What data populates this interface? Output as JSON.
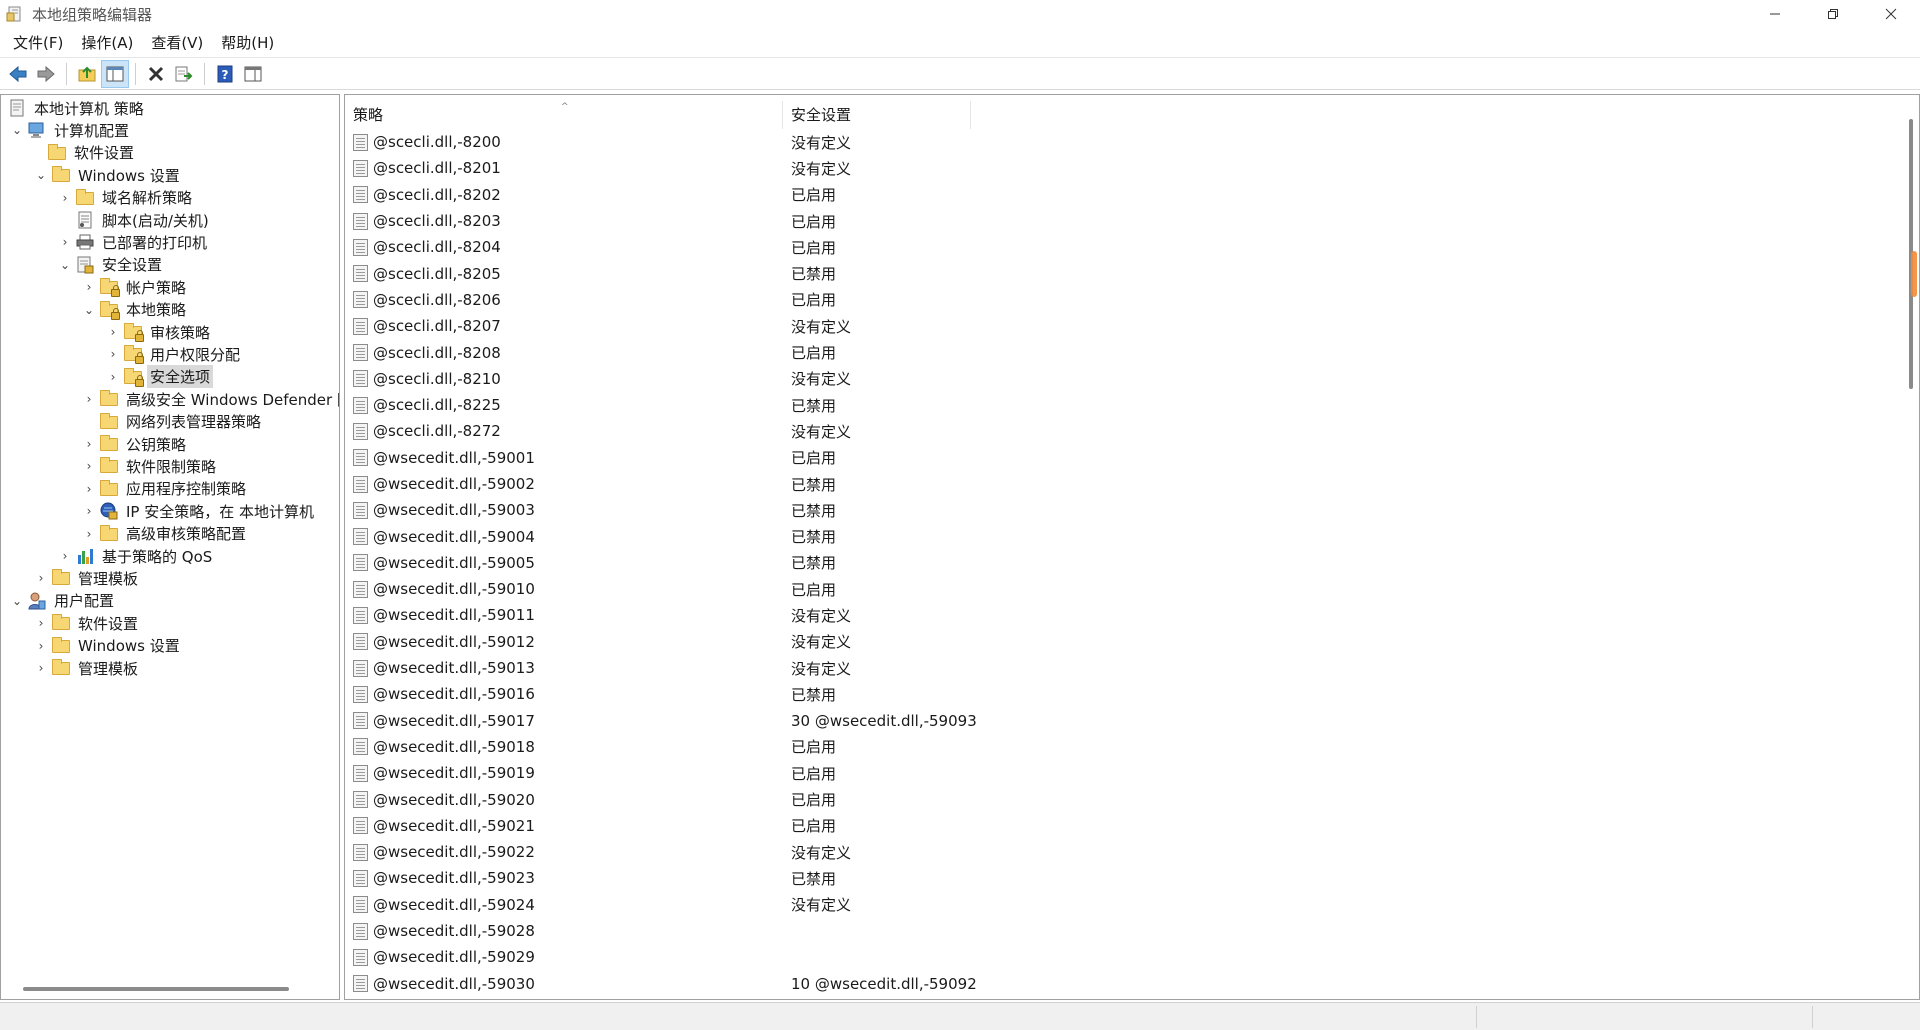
{
  "window": {
    "title": "本地组策略编辑器",
    "icon": "gpedit-app-icon",
    "controls": [
      "minimize-icon",
      "restore-icon",
      "close-icon"
    ]
  },
  "menu": {
    "file": "文件(F)",
    "action": "操作(A)",
    "view": "查看(V)",
    "help": "帮助(H)"
  },
  "toolbar": {
    "buttons": [
      "back-arrow-icon",
      "forward-arrow-icon",
      "up-folder-icon",
      "show-hide-tree-icon",
      "delete-icon",
      "export-list-icon",
      "help-icon",
      "properties-pane-icon"
    ]
  },
  "tree": {
    "items": [
      {
        "label": "本地计算机 策略",
        "icon": "policy-doc"
      },
      {
        "label": "计算机配置",
        "icon": "computer"
      },
      {
        "label": "软件设置",
        "icon": "folder"
      },
      {
        "label": "Windows 设置",
        "icon": "folder"
      },
      {
        "label": "域名解析策略",
        "icon": "folder"
      },
      {
        "label": "脚本(启动/关机)",
        "icon": "script"
      },
      {
        "label": "已部署的打印机",
        "icon": "printer"
      },
      {
        "label": "安全设置",
        "icon": "security"
      },
      {
        "label": "帐户策略",
        "icon": "folder-lock"
      },
      {
        "label": "本地策略",
        "icon": "folder-lock"
      },
      {
        "label": "审核策略",
        "icon": "folder-lock"
      },
      {
        "label": "用户权限分配",
        "icon": "folder-lock"
      },
      {
        "label": "安全选项",
        "icon": "folder-lock"
      },
      {
        "label": "高级安全 Windows Defender 防",
        "icon": "folder"
      },
      {
        "label": "网络列表管理器策略",
        "icon": "folder"
      },
      {
        "label": "公钥策略",
        "icon": "folder"
      },
      {
        "label": "软件限制策略",
        "icon": "folder"
      },
      {
        "label": "应用程序控制策略",
        "icon": "folder"
      },
      {
        "label": "IP 安全策略，在 本地计算机",
        "icon": "ip-security"
      },
      {
        "label": "高级审核策略配置",
        "icon": "folder"
      },
      {
        "label": "基于策略的 QoS",
        "icon": "qos-chart"
      },
      {
        "label": "管理模板",
        "icon": "folder"
      },
      {
        "label": "用户配置",
        "icon": "user"
      },
      {
        "label": "软件设置",
        "icon": "folder"
      },
      {
        "label": "Windows 设置",
        "icon": "folder"
      },
      {
        "label": "管理模板",
        "icon": "folder"
      }
    ]
  },
  "list": {
    "columns": {
      "policy": "策略",
      "setting": "安全设置"
    },
    "rows": [
      {
        "policy": "@scecli.dll,-8200",
        "setting": "没有定义"
      },
      {
        "policy": "@scecli.dll,-8201",
        "setting": "没有定义"
      },
      {
        "policy": "@scecli.dll,-8202",
        "setting": "已启用"
      },
      {
        "policy": "@scecli.dll,-8203",
        "setting": "已启用"
      },
      {
        "policy": "@scecli.dll,-8204",
        "setting": "已启用"
      },
      {
        "policy": "@scecli.dll,-8205",
        "setting": "已禁用"
      },
      {
        "policy": "@scecli.dll,-8206",
        "setting": "已启用"
      },
      {
        "policy": "@scecli.dll,-8207",
        "setting": "没有定义"
      },
      {
        "policy": "@scecli.dll,-8208",
        "setting": "已启用"
      },
      {
        "policy": "@scecli.dll,-8210",
        "setting": "没有定义"
      },
      {
        "policy": "@scecli.dll,-8225",
        "setting": "已禁用"
      },
      {
        "policy": "@scecli.dll,-8272",
        "setting": "没有定义"
      },
      {
        "policy": "@wsecedit.dll,-59001",
        "setting": "已启用"
      },
      {
        "policy": "@wsecedit.dll,-59002",
        "setting": "已禁用"
      },
      {
        "policy": "@wsecedit.dll,-59003",
        "setting": "已禁用"
      },
      {
        "policy": "@wsecedit.dll,-59004",
        "setting": "已禁用"
      },
      {
        "policy": "@wsecedit.dll,-59005",
        "setting": "已禁用"
      },
      {
        "policy": "@wsecedit.dll,-59010",
        "setting": "已启用"
      },
      {
        "policy": "@wsecedit.dll,-59011",
        "setting": "没有定义"
      },
      {
        "policy": "@wsecedit.dll,-59012",
        "setting": "没有定义"
      },
      {
        "policy": "@wsecedit.dll,-59013",
        "setting": "没有定义"
      },
      {
        "policy": "@wsecedit.dll,-59016",
        "setting": "已禁用"
      },
      {
        "policy": "@wsecedit.dll,-59017",
        "setting": "30 @wsecedit.dll,-59093"
      },
      {
        "policy": "@wsecedit.dll,-59018",
        "setting": "已启用"
      },
      {
        "policy": "@wsecedit.dll,-59019",
        "setting": "已启用"
      },
      {
        "policy": "@wsecedit.dll,-59020",
        "setting": "已启用"
      },
      {
        "policy": "@wsecedit.dll,-59021",
        "setting": "已启用"
      },
      {
        "policy": "@wsecedit.dll,-59022",
        "setting": "没有定义"
      },
      {
        "policy": "@wsecedit.dll,-59023",
        "setting": "已禁用"
      },
      {
        "policy": "@wsecedit.dll,-59024",
        "setting": "没有定义"
      },
      {
        "policy": "@wsecedit.dll,-59028",
        "setting": ""
      },
      {
        "policy": "@wsecedit.dll,-59029",
        "setting": ""
      },
      {
        "policy": "@wsecedit.dll,-59030",
        "setting": "10 @wsecedit.dll,-59092"
      }
    ]
  },
  "colors": {
    "selection": "#d9d9d9",
    "folder": "#f7d774",
    "scroll_accent": "#f48a35"
  }
}
